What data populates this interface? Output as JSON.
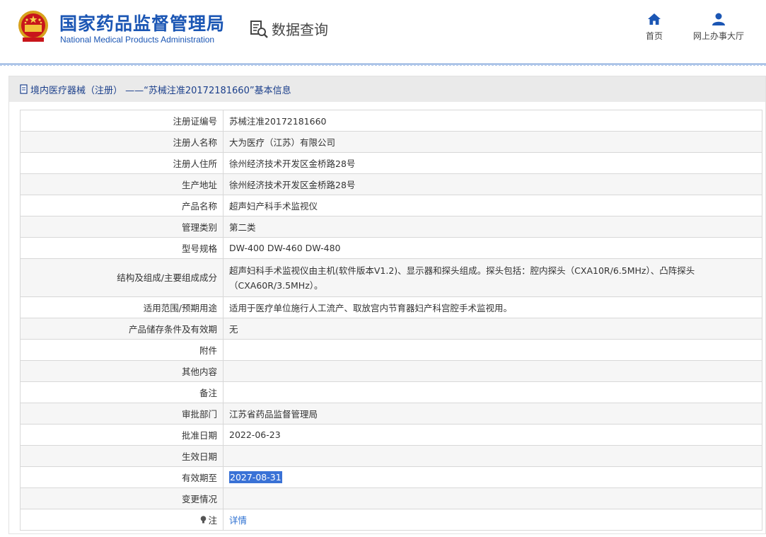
{
  "header": {
    "brand_cn": "国家药品监督管理局",
    "brand_en": "National Medical Products Administration",
    "query_label": "数据查询",
    "nav": [
      {
        "label": "首页",
        "icon": "home-icon"
      },
      {
        "label": "网上办事大厅",
        "icon": "user-icon"
      }
    ],
    "accent_color": "#1b56b4"
  },
  "panel": {
    "title": "境内医疗器械（注册） ——“苏械注准20172181660”基本信息"
  },
  "rows": [
    {
      "label": "注册证编号",
      "value": "苏械注准20172181660"
    },
    {
      "label": "注册人名称",
      "value": "大为医疗（江苏）有限公司"
    },
    {
      "label": "注册人住所",
      "value": "徐州经济技术开发区金桥路28号"
    },
    {
      "label": "生产地址",
      "value": "徐州经济技术开发区金桥路28号"
    },
    {
      "label": "产品名称",
      "value": "超声妇产科手术监视仪"
    },
    {
      "label": "管理类别",
      "value": "第二类"
    },
    {
      "label": "型号规格",
      "value": "DW-400 DW-460 DW-480"
    },
    {
      "label": "结构及组成/主要组成成分",
      "value": "超声妇科手术监视仪由主机(软件版本V1.2)、显示器和探头组成。探头包括：腔内探头（CXA10R/6.5MHz）、凸阵探头（CXA60R/3.5MHz）。"
    },
    {
      "label": "适用范围/预期用途",
      "value": "适用于医疗单位施行人工流产、取放宫内节育器妇产科宫腔手术监视用。"
    },
    {
      "label": "产品储存条件及有效期",
      "value": "无"
    },
    {
      "label": "附件",
      "value": ""
    },
    {
      "label": "其他内容",
      "value": ""
    },
    {
      "label": "备注",
      "value": ""
    },
    {
      "label": "审批部门",
      "value": "江苏省药品监督管理局"
    },
    {
      "label": "批准日期",
      "value": "2022-06-23"
    },
    {
      "label": "生效日期",
      "value": ""
    },
    {
      "label": "有效期至",
      "value": "2027-08-31"
    },
    {
      "label": "变更情况",
      "value": ""
    },
    {
      "label": "注",
      "value": "详情"
    }
  ]
}
